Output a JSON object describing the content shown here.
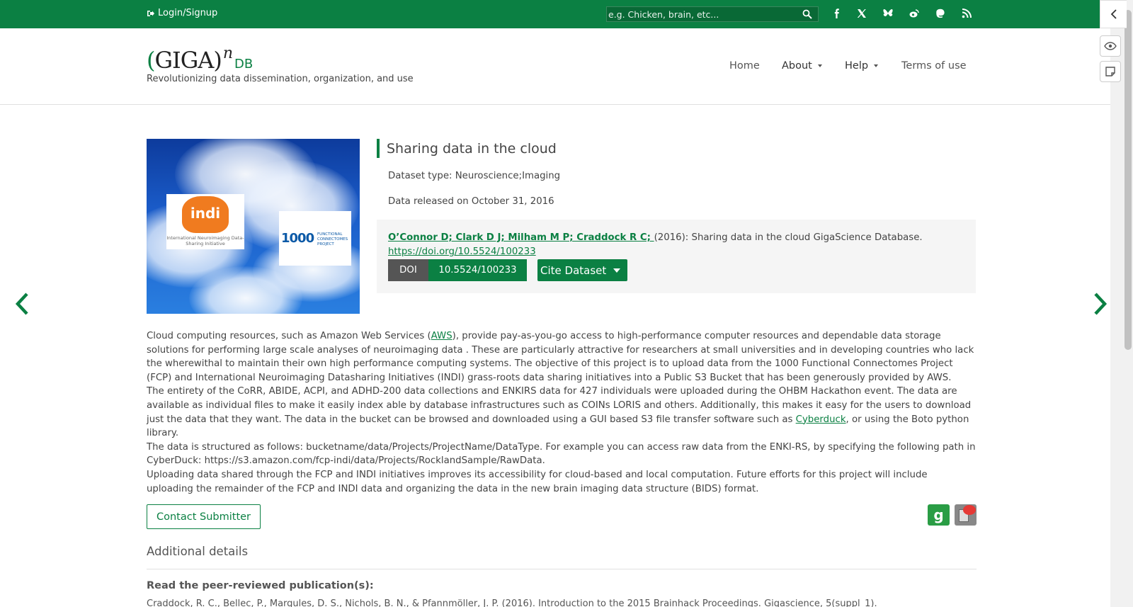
{
  "topbar": {
    "login_label": "Login/Signup",
    "search_placeholder": "e.g. Chicken, brain, etc...",
    "social_icons": [
      "facebook-icon",
      "x-icon",
      "bluesky-icon",
      "weibo-icon",
      "mastodon-icon",
      "rss-icon"
    ],
    "color": "#0b8043"
  },
  "header": {
    "logo": {
      "open": "(",
      "giga": "GIGA",
      "close": ")",
      "sup": "n",
      "db": "DB"
    },
    "tagline": "Revolutionizing data dissemination, organization, and use",
    "nav": {
      "home": "Home",
      "about": "About",
      "help": "Help",
      "terms": "Terms of use"
    }
  },
  "cover": {
    "indi_logo": "indi",
    "indi_caption": "International Neuroimaging Data-Sharing Initiative",
    "fcp_number": "1000",
    "fcp_caption": "FUNCTIONAL CONNECTOMES PROJECT"
  },
  "dataset": {
    "title": "Sharing data in the cloud",
    "type": "Dataset type: Neuroscience;Imaging",
    "released": "Data released on October 31, 2016",
    "authors": "O’Connor D; Clark D J; Milham M P; Craddock R C; ",
    "citation_rest": "(2016): Sharing data in the cloud GigaScience Database.",
    "doi_url": "https://doi.org/10.5524/100233",
    "doi_label": "DOI",
    "doi_value": "10.5524/100233",
    "cite_button": "Cite Dataset"
  },
  "description": {
    "p1_a": "Cloud computing resources, such as Amazon Web Services (",
    "p1_link": "AWS",
    "p1_b": "), provide pay-as-you-go access to high-performance computer resources and dependable data storage solutions for performing large scale analyses of neuroimaging data . These are particularly attractive for researchers at small universities and in developing countries who lack the wherewithal to maintain their own high performance computing systems. The objective of this project is to upload data from the 1000 Functional Connectomes Project (FCP) and International Neuroimaging Datasharing Initiatives (INDI) grass-roots data sharing initiatives into a Public S3 Bucket that has been generously provided by AWS.",
    "p2_a": "The entirety of the CoRR, ABIDE, ACPI, and ADHD-200 data collections and ENKIRS data for 427 individuals were uploaded during the OHBM Hackathon event. The data are available as individual files to make it easily index able by database infrastructures such as COINs LORIS and others. Additionally, this makes it easy for the users to download just the data that they want. The data in the bucket can be browsed and downloaded using a GUI based S3 file transfer software such as ",
    "p2_link": "Cyberduck",
    "p2_b": ", or using the Boto python library.",
    "p3": "The data is structured as follows: bucketname/data/Projects/ProjectName/DataType. For example you can access raw data from the ENKI-RS, by specifying the following path in CyberDuck: https://s3.amazon.com/fcp-indi/data/Projects/RocklandSample/RawData.",
    "p4": "Uploading data shared through the FCP and INDI initiatives improves its accessibility for cloud-based and local computation. Future efforts for this project will include uploading the remainder of the FCP and INDI data and organizing the data in the new brain imaging data structure (BIDS) format."
  },
  "actions": {
    "contact": "Contact Submitter",
    "scholar_icon_label": "g"
  },
  "additional": {
    "title": "Additional details",
    "pub_heading": "Read the peer-reviewed publication(s):",
    "pub_ref": "Craddock, R. C., Bellec, P., Margules, D. S., Nichols, B. N., & Pfannmöller, J. P. (2016). Introduction to the 2015 Brainhack Proceedings. Gigascience, 5(suppl_1)."
  }
}
